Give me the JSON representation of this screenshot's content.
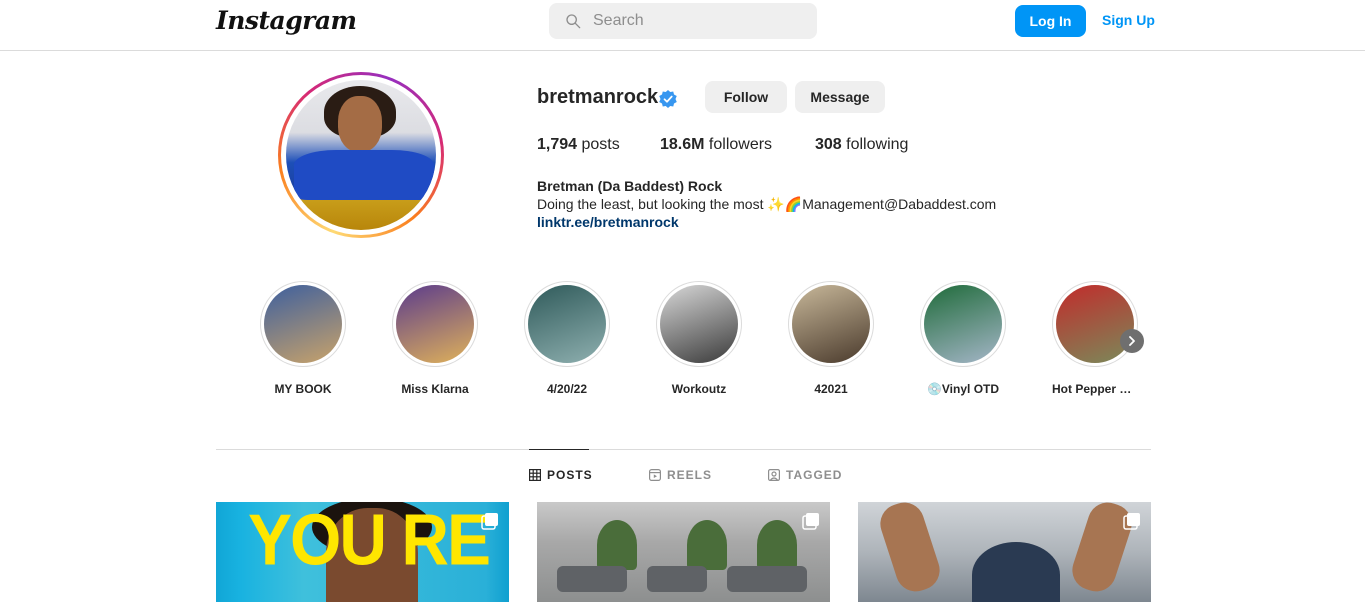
{
  "header": {
    "logo_text": "Instagram",
    "search_placeholder": "Search",
    "login_label": "Log In",
    "signup_label": "Sign Up"
  },
  "profile": {
    "username": "bretmanrock",
    "verified": true,
    "follow_label": "Follow",
    "message_label": "Message",
    "stats": {
      "posts_count": "1,794",
      "posts_label": "posts",
      "followers_count": "18.6M",
      "followers_label": "followers",
      "following_count": "308",
      "following_label": "following"
    },
    "bio_name": "Bretman (Da Baddest) Rock",
    "bio_text": "Doing the least, but looking the most ✨🌈Management@Dabaddest.com",
    "bio_link": "linktr.ee/bretmanrock"
  },
  "highlights": [
    {
      "label": "MY BOOK",
      "color_a": "#3d5f9e",
      "color_b": "#c9a36a"
    },
    {
      "label": "Miss Klarna",
      "color_a": "#5b3b8c",
      "color_b": "#e0b25a"
    },
    {
      "label": "4/20/22",
      "color_a": "#2f5a5a",
      "color_b": "#8fb0b0"
    },
    {
      "label": "Workoutz",
      "color_a": "#d8d8d8",
      "color_b": "#3a3a3a"
    },
    {
      "label": "42021",
      "color_a": "#c8b89a",
      "color_b": "#4a3a2c"
    },
    {
      "label": "💿Vinyl OTD",
      "color_a": "#1f6b3a",
      "color_b": "#a5b6c8"
    },
    {
      "label": "Hot Pepper O...",
      "color_a": "#c22b2b",
      "color_b": "#7a8a5a"
    }
  ],
  "tabs": [
    {
      "label": "POSTS",
      "active": true,
      "icon": "grid-icon"
    },
    {
      "label": "REELS",
      "active": false,
      "icon": "reels-icon"
    },
    {
      "label": "TAGGED",
      "active": false,
      "icon": "tagged-icon"
    }
  ],
  "posts": [
    {
      "overlay_text": "YOU RE",
      "multi": true
    },
    {
      "multi": true
    },
    {
      "multi": true
    }
  ],
  "colors": {
    "accent": "#0095f6",
    "link": "#00376b",
    "text": "#262626",
    "muted": "#8e8e8e",
    "border": "#dbdbdb",
    "button_bg": "#efefef"
  }
}
